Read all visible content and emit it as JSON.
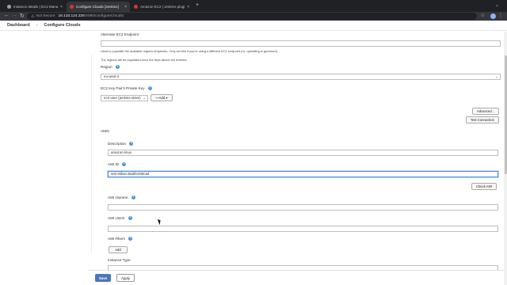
{
  "browser": {
    "tabs": [
      {
        "title": "Instance details | EC2 Manag…",
        "close": "×",
        "active": false
      },
      {
        "title": "Configure Clouds [Jenkins]",
        "close": "×",
        "active": true
      },
      {
        "title": "Amazon EC2 | Jenkins plugin",
        "close": "×",
        "active": false
      }
    ],
    "new_tab": "+",
    "window_menu": "⌄",
    "nav": {
      "back": "←",
      "forward": "→",
      "reload": "↻"
    },
    "security_label": "Not Secure",
    "url_host": "18.133.124.229",
    "url_path": ":8080/configureClouds/",
    "star": "☆",
    "kebab": "⋮"
  },
  "breadcrumb": {
    "items": [
      "Dashboard",
      "Configure Clouds"
    ],
    "separator": "›"
  },
  "form": {
    "alternate_endpoint": {
      "label": "Alternate EC2 Endpoint",
      "value": "",
      "desc1": "Used to populate the available regions dropdown. Only set this if you're using a different EC2 endpoint (i.e. operating in govcloud).",
      "desc2": "The regions will be populated once the keys above are entered."
    },
    "region": {
      "label": "Region",
      "value": "eu-west-2",
      "help": "?"
    },
    "key_pair": {
      "label": "EC2 Key Pair's Private Key",
      "help": "?",
      "value": "ec2-user (jenkins-slave)",
      "add_label": "⊶Add ▾"
    },
    "advanced_label": "Advanced...",
    "test_connection_label": "Test Connection",
    "amis_title": "AMIs",
    "description": {
      "label": "Description",
      "value": "amazon-linux",
      "help": "?"
    },
    "ami_id": {
      "label": "AMI ID",
      "value": "ami-0dbec48abfe298cad",
      "help": "?"
    },
    "check_ami_label": "Check AMI",
    "ami_owners": {
      "label": "AMI Owners",
      "value": "",
      "help": "?"
    },
    "ami_users": {
      "label": "AMI Users",
      "value": "",
      "help": "?"
    },
    "ami_filters": {
      "label": "AMI Filters",
      "help": "?",
      "add_label": "Add"
    },
    "instance_type": {
      "label": "Instance Type"
    }
  },
  "actions": {
    "save_label": "Save",
    "apply_label": "Apply"
  },
  "colors": {
    "primary_button": "#4b76b9",
    "focus": "#4a90e2",
    "help_icon": "#4a90e2",
    "chrome_dark": "#202124"
  }
}
